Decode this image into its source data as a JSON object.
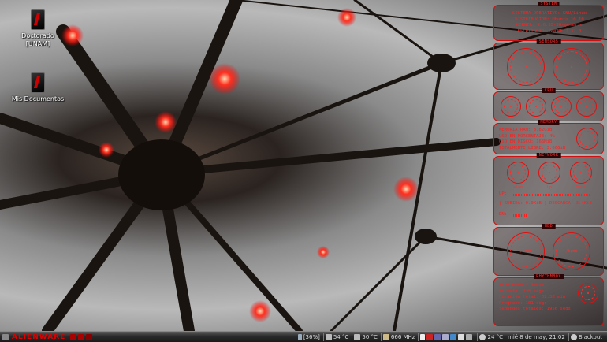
{
  "desktop": {
    "icons": [
      {
        "label_line1": "Doctorado",
        "label_line2": "[UNAM]"
      },
      {
        "label_line1": "Mis Documentos",
        "label_line2": ""
      }
    ]
  },
  "conky": {
    "system": {
      "title": "SYSTEM",
      "lines": [
        "SISTEMA OPERATIVO: GNU/Linux",
        "DISTRIBUCION: Ubuntu 10.10",
        "KERNEL: 2.6.35-30-generic",
        "ESCRITORIO: GNOME 2.32.0"
      ]
    },
    "sensors_title": "SENSORS",
    "cpu_title": "CPU",
    "memory": {
      "title": "MEMORY",
      "lines": [
        "MEMORIA RAM: 3.82GiB",
        "USO EN PORCENTAJE: 4%",
        "USO EN DISCO: 166MiB",
        "TOTALMENTE LIBRE: 3.66GiB"
      ]
    },
    "network": {
      "title": "NETWORK",
      "gauge_labels": [
        "wlan",
        "Up",
        "Down"
      ],
      "up_label": "UP:",
      "status_line": "| SUBIDA: 0.0KiB | DESCARGA: 3.4KiB",
      "dn_label": "DN:"
    },
    "hdd": {
      "title": "HDD",
      "gauges": [
        "/root",
        "/home"
      ]
    },
    "music": {
      "title": "RHYTHMBOX",
      "lines": [
        "Tray Ruon - Seesm",
        "Bitrate: 235 segs",
        "Duracion total: 32.38 min",
        "Progreso: 101 segs",
        "Segundos totales: 1956 segs"
      ]
    }
  },
  "taskbar": {
    "brand": "ALIENWARE",
    "battery": "[36%]",
    "temp1": "54 °C",
    "temp2": "50 °C",
    "cpu_freq": "666 MHz",
    "weather": "24 °C",
    "datetime": "mié  8 de may, 21:02",
    "user": "Blackout"
  },
  "colors": {
    "accent": "#ff2020",
    "panel_border": "#d01010"
  }
}
